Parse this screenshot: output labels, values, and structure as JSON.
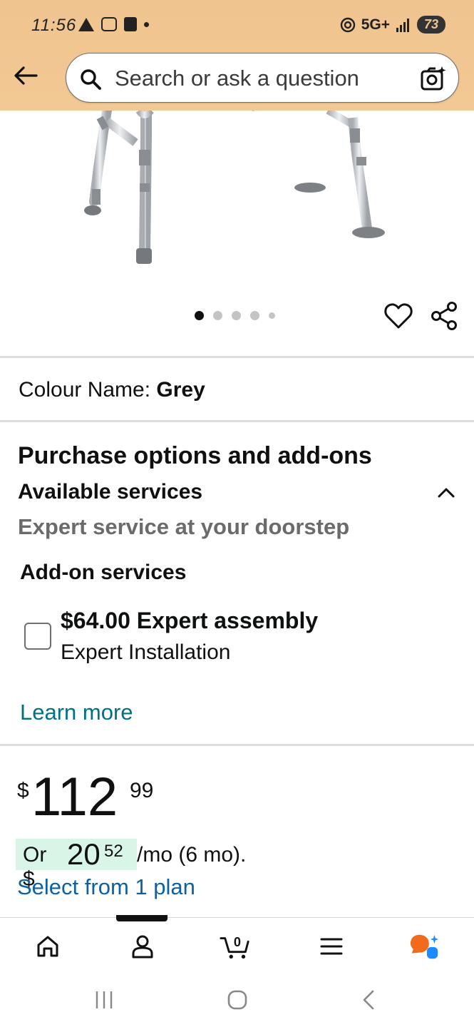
{
  "status_bar": {
    "time": "11:56",
    "network": "5G+",
    "battery": "73"
  },
  "search": {
    "placeholder": "Search or ask a question"
  },
  "carousel": {
    "total_dots": 5,
    "active_index": 0
  },
  "product": {
    "colour_label": "Colour Name: ",
    "colour_value": "Grey"
  },
  "purchase_options": {
    "heading": "Purchase options and add-ons",
    "available_services": "Available services",
    "expert_tagline": "Expert service at your doorstep",
    "addon_heading": "Add-on services",
    "addon_item": {
      "title": "$64.00 Expert assembly",
      "subtitle": "Expert Installation",
      "checked": false
    },
    "learn_more": "Learn more"
  },
  "price": {
    "symbol": "$",
    "whole": "112",
    "fraction": "99"
  },
  "installment": {
    "prefix": "Or $",
    "whole": "20",
    "fraction": "52",
    "suffix": " /mo (6 mo).",
    "select_plan": "Select from 1 plan"
  },
  "bottom_nav": {
    "cart_count": "0",
    "items": [
      "home-icon",
      "account-icon",
      "cart-icon",
      "menu-icon",
      "assistant-icon"
    ]
  },
  "colors": {
    "header_bg": "#f0c48f",
    "link_teal": "#007185",
    "link_blue": "#0b61a4",
    "installment_highlight": "#d8f5e8",
    "assistant_orange": "#f26b1d",
    "assistant_blue": "#1a8cff"
  }
}
